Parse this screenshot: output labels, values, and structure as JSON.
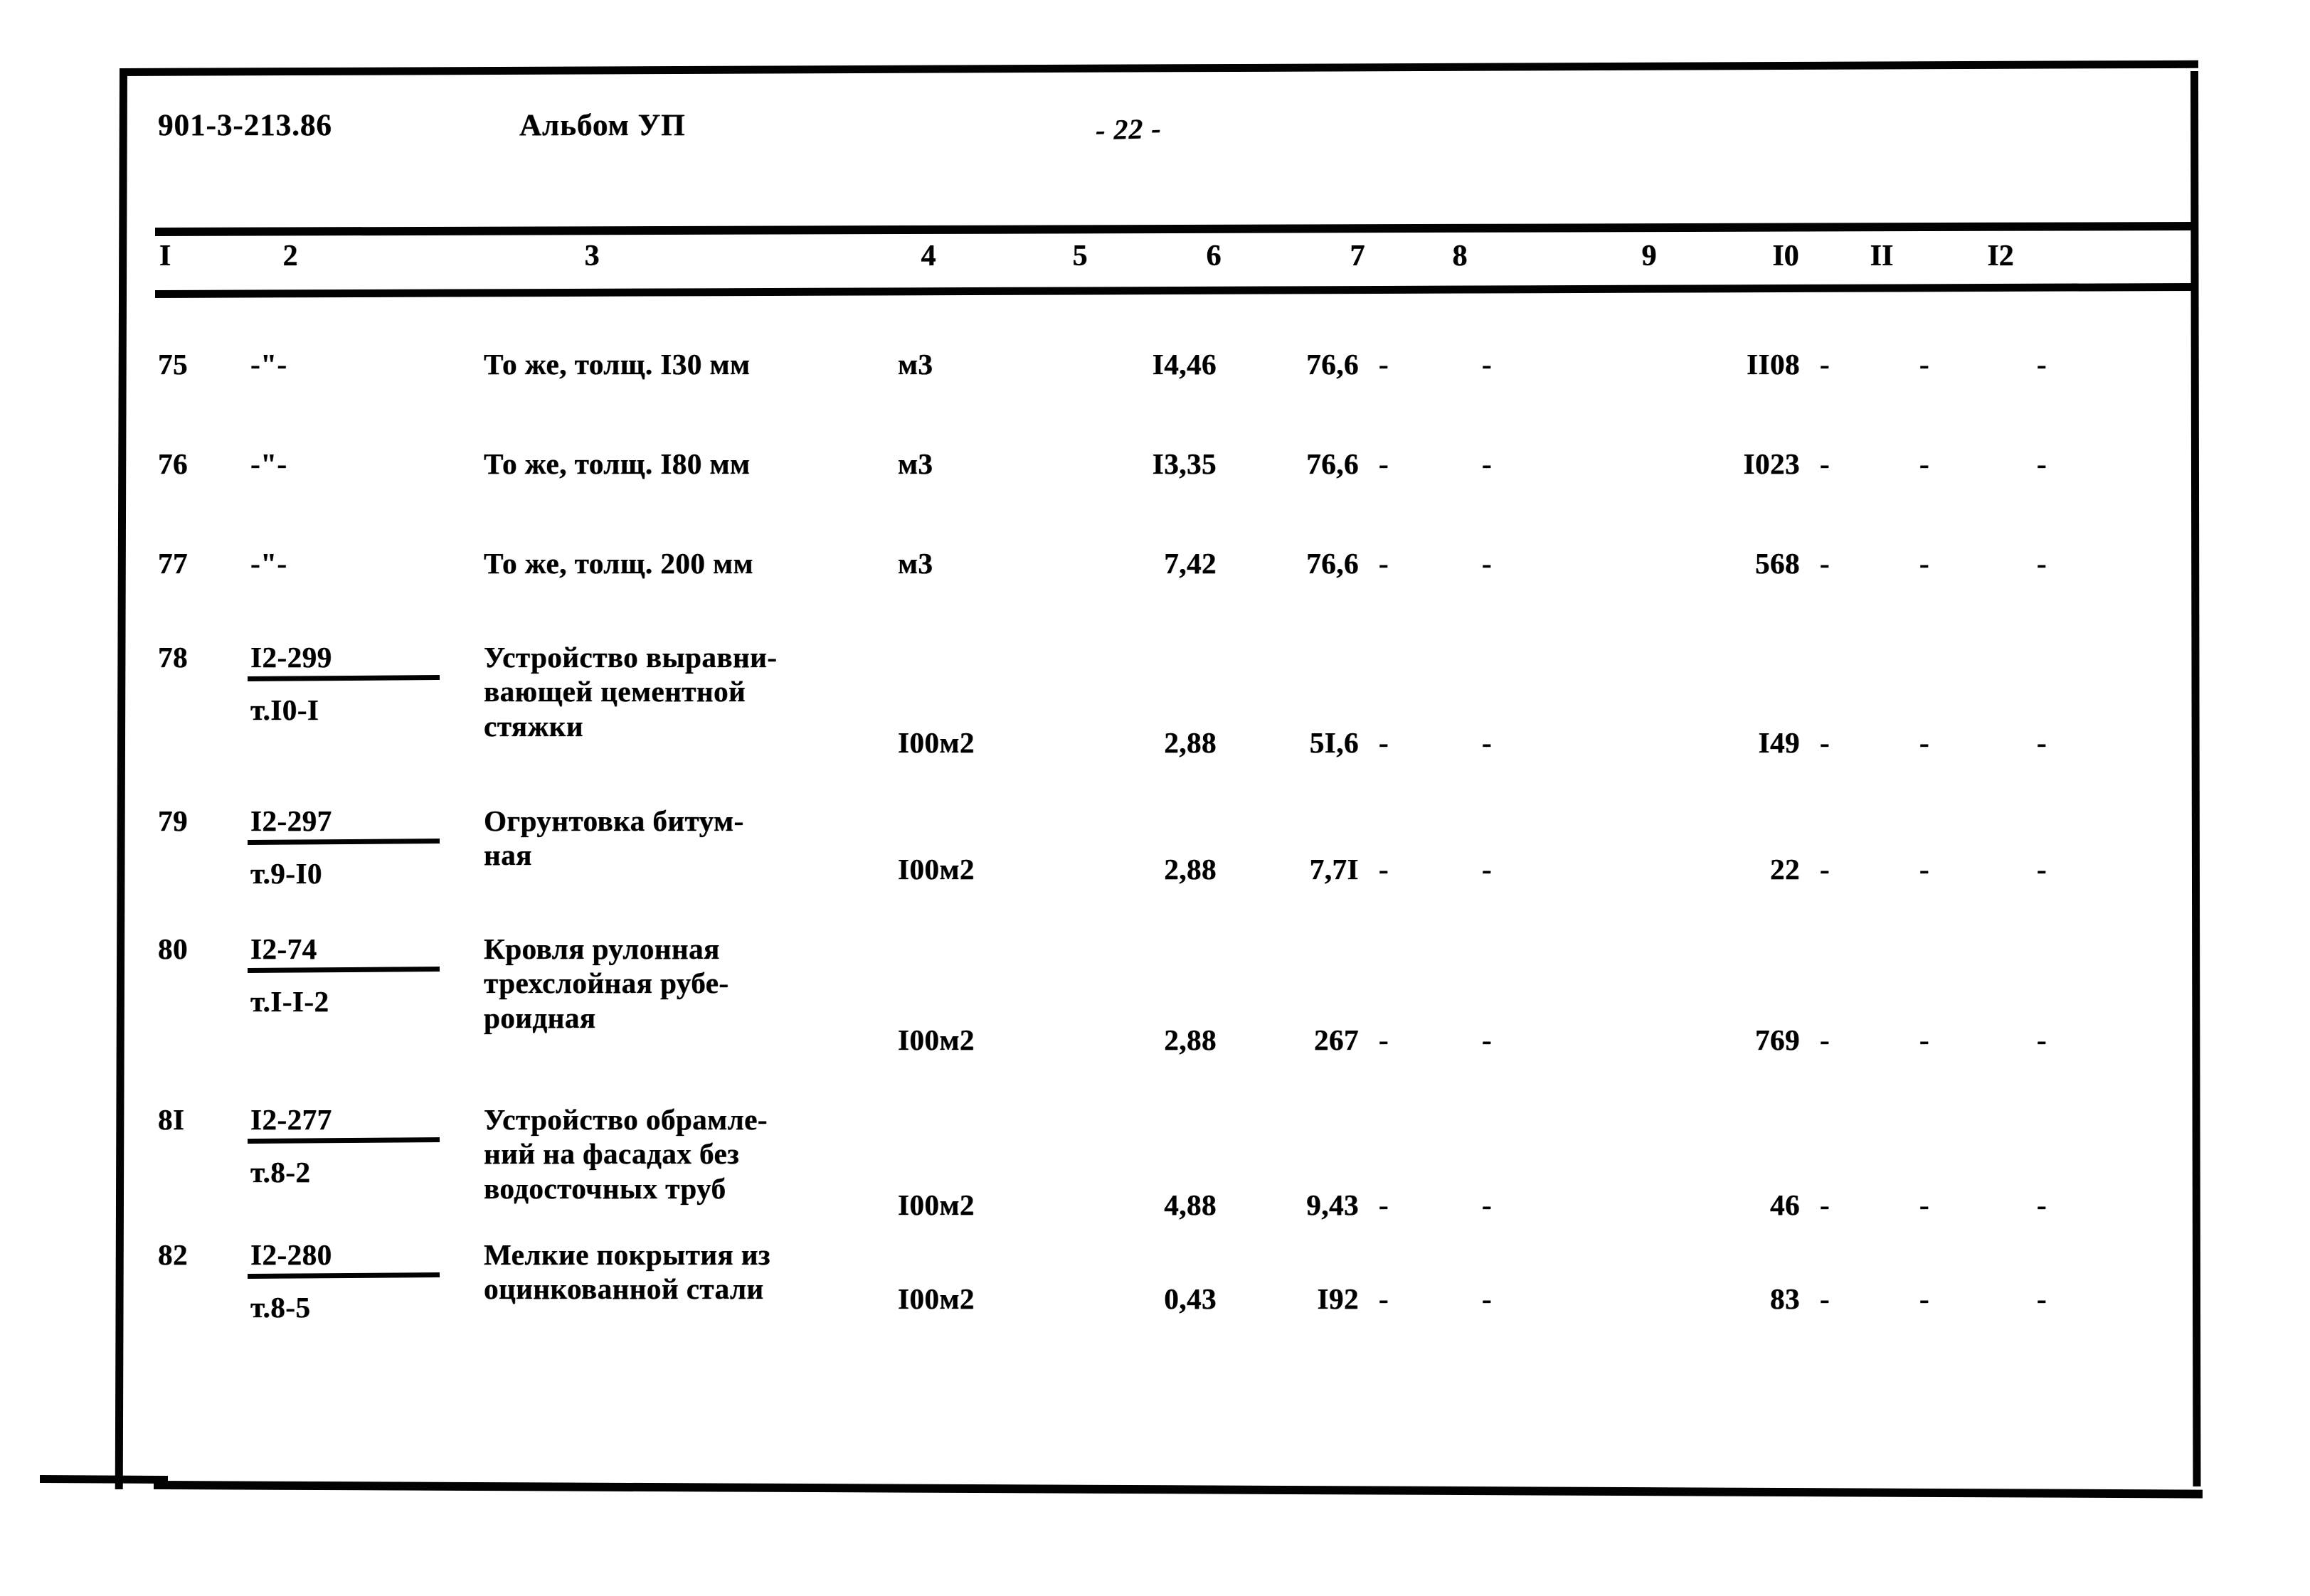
{
  "header": {
    "doc_code": "901-3-213.86",
    "album": "Альбом УП",
    "page_number": "- 22 -"
  },
  "table": {
    "column_headers": [
      "I",
      "2",
      "3",
      "4",
      "5",
      "6",
      "7",
      "8",
      "9",
      "I0",
      "II",
      "I2"
    ],
    "rows": [
      {
        "no": "75",
        "code_top": "",
        "code_bottom": "",
        "code_ditto": "-\"-",
        "description": [
          "То же, толщ. I30 мм"
        ],
        "unit": "м3",
        "c5": "I4,46",
        "c6": "76,6",
        "c7": "-",
        "c8": "-",
        "c9": "II08",
        "c10": "-",
        "c11": "-",
        "c12": "-"
      },
      {
        "no": "76",
        "code_top": "",
        "code_bottom": "",
        "code_ditto": "-\"-",
        "description": [
          "То же, толщ. I80 мм"
        ],
        "unit": "м3",
        "c5": "I3,35",
        "c6": "76,6",
        "c7": "-",
        "c8": "-",
        "c9": "I023",
        "c10": "-",
        "c11": "-",
        "c12": "-"
      },
      {
        "no": "77",
        "code_top": "",
        "code_bottom": "",
        "code_ditto": "-\"-",
        "description": [
          "То же, толщ. 200 мм"
        ],
        "unit": "м3",
        "c5": "7,42",
        "c6": "76,6",
        "c7": "-",
        "c8": "-",
        "c9": "568",
        "c10": "-",
        "c11": "-",
        "c12": "-"
      },
      {
        "no": "78",
        "code_top": "I2-299",
        "code_bottom": "т.I0-I",
        "code_ditto": "",
        "description": [
          "Устройство выравни-",
          "вающей цементной",
          "стяжки"
        ],
        "unit": "I00м2",
        "c5": "2,88",
        "c6": "5I,6",
        "c7": "-",
        "c8": "-",
        "c9": "I49",
        "c10": "-",
        "c11": "-",
        "c12": "-"
      },
      {
        "no": "79",
        "code_top": "I2-297",
        "code_bottom": "т.9-I0",
        "code_ditto": "",
        "description": [
          "Огрунтовка битум-",
          "ная"
        ],
        "unit": "I00м2",
        "c5": "2,88",
        "c6": "7,7I",
        "c7": "-",
        "c8": "-",
        "c9": "22",
        "c10": "-",
        "c11": "-",
        "c12": "-"
      },
      {
        "no": "80",
        "code_top": "I2-74",
        "code_bottom": "т.I-I-2",
        "code_ditto": "",
        "description": [
          "Кровля рулонная",
          "трехслойная рубе-",
          "роидная"
        ],
        "unit": "I00м2",
        "c5": "2,88",
        "c6": "267",
        "c7": "-",
        "c8": "-",
        "c9": "769",
        "c10": "-",
        "c11": "-",
        "c12": "-"
      },
      {
        "no": "8I",
        "code_top": "I2-277",
        "code_bottom": "т.8-2",
        "code_ditto": "",
        "description": [
          "Устройство обрамле-",
          "ний на фасадах без",
          "водосточных труб"
        ],
        "unit": "I00м2",
        "c5": "4,88",
        "c6": "9,43",
        "c7": "-",
        "c8": "-",
        "c9": "46",
        "c10": "-",
        "c11": "-",
        "c12": "-"
      },
      {
        "no": "82",
        "code_top": "I2-280",
        "code_bottom": "т.8-5",
        "code_ditto": "",
        "description": [
          "Мелкие покрытия из",
          "оцинкованной стали"
        ],
        "unit": "I00м2",
        "c5": "0,43",
        "c6": "I92",
        "c7": "-",
        "c8": "-",
        "c9": "83",
        "c10": "-",
        "c11": "-",
        "c12": "-"
      }
    ]
  },
  "layout": {
    "col_x": {
      "no": 222,
      "code": 352,
      "desc": 680,
      "unit": 1262,
      "c5": 1560,
      "c6": 1760,
      "c7": 1905,
      "c8": 2050,
      "c9": 2370,
      "c10": 2525,
      "c11": 2665,
      "c12": 2830
    },
    "header_center_x": {
      "I": 232,
      "2": 408,
      "3": 832,
      "4": 1305,
      "5": 1518,
      "6": 1706,
      "7": 1908,
      "8": 2052,
      "9": 2318,
      "I0": 2510,
      "II": 2645,
      "I2": 2812
    },
    "row_tops": [
      58,
      198,
      338,
      470,
      700,
      880,
      1120,
      1310
    ],
    "row_desc_baseline_offset": [
      0,
      0,
      0,
      0,
      0,
      0,
      0,
      0
    ],
    "row_num_offset": [
      0,
      0,
      0,
      120,
      68,
      128,
      120,
      62
    ]
  },
  "colors": {
    "ink": "#0a0a0a",
    "paper": "#ffffff"
  }
}
